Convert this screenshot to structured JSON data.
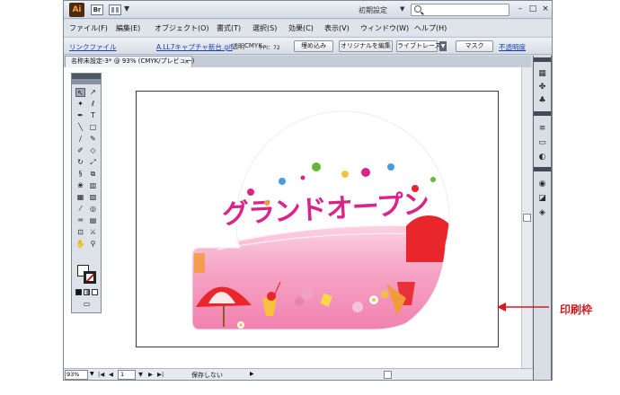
{
  "titlebar": {
    "app_logo": "Ai",
    "bridge": "Br",
    "workspace": "初期設定",
    "workspace_arrow": "▼",
    "minimize": "–",
    "maximize": "□",
    "close": "×"
  },
  "menus": [
    "ファイル(F)",
    "編集(E)",
    "オブジェクト(O)",
    "書式(T)",
    "選択(S)",
    "効果(C)",
    "表示(V)",
    "ウィンドウ(W)",
    "ヘルプ(H)"
  ],
  "control": {
    "linked_file": "リンクファイル",
    "filename": "A.LL7キャプチャ新台.gif",
    "transparency": "透明",
    "color_mode": "CMYK",
    "ppi_label": "PPI：72",
    "embed": "埋め込み",
    "edit_original": "オリジナルを編集",
    "live_trace": "ライブトレース",
    "mask": "マスク",
    "opacity": "不透明度"
  },
  "document": {
    "tab_title": "名称未設定-3* @ 93% (CMYK/プレビュー)",
    "tab_close": "×"
  },
  "artwork": {
    "title": "グランドオープン"
  },
  "status": {
    "zoom": "93%",
    "page": "1",
    "status_text": "保存しない",
    "nav_first": "|◀",
    "nav_prev": "◀",
    "nav_next": "▶",
    "nav_last": "▶|",
    "dropdown_arrow": "▼",
    "status_arrow": "▶"
  },
  "annotation": {
    "label": "印刷枠"
  },
  "colors": {
    "annotation_red": "#d61a1f",
    "banner_pink": "#f06aa0",
    "title_green": "#63b83b",
    "title_blue": "#4a9be0",
    "title_magenta": "#d9258a"
  }
}
